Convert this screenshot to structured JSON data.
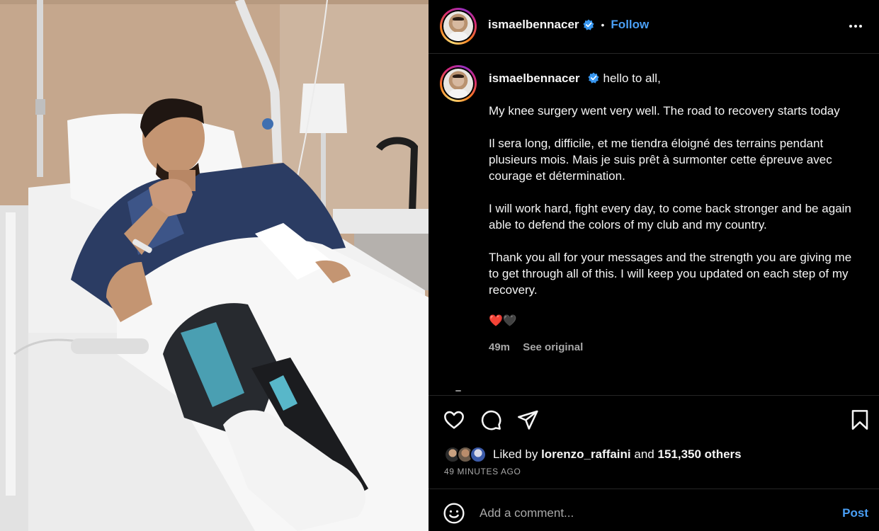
{
  "post": {
    "username": "ismaelbennacer",
    "follow_label": "Follow",
    "separator": "•",
    "verified_icon": "verified-badge-icon",
    "caption": {
      "greeting": "hello to all,",
      "paragraphs": [
        "My knee surgery went very well. The road to recovery starts today",
        "Il sera long, difficile, et me tiendra éloigné des terrains pendant plusieurs mois. Mais je suis prêt à surmonter cette épreuve avec courage et détermination.",
        "I will work hard, fight every day, to come back stronger and be again able to defend the colors of my club and my country.",
        "Thank you all for your messages and the strength you are giving me to get through all of this. I will keep you updated on each step of my recovery."
      ],
      "emojis": "❤️🖤",
      "age": "49m",
      "see_original": "See original"
    },
    "likes": {
      "prefix": "Liked by",
      "user": "lorenzo_raffaini",
      "and": "and",
      "others": "151,350 others"
    },
    "time_ago": "49 MINUTES AGO",
    "comment": {
      "placeholder": "Add a comment...",
      "post_label": "Post"
    },
    "icons": {
      "like": "heart-icon",
      "comment": "comment-icon",
      "share": "share-icon",
      "save": "bookmark-icon",
      "emoji": "emoji-icon",
      "more": "more-options-icon"
    },
    "colors": {
      "accent": "#4a9ff5",
      "background": "#000000",
      "muted": "#a8a8a8",
      "divider": "#262626"
    }
  }
}
